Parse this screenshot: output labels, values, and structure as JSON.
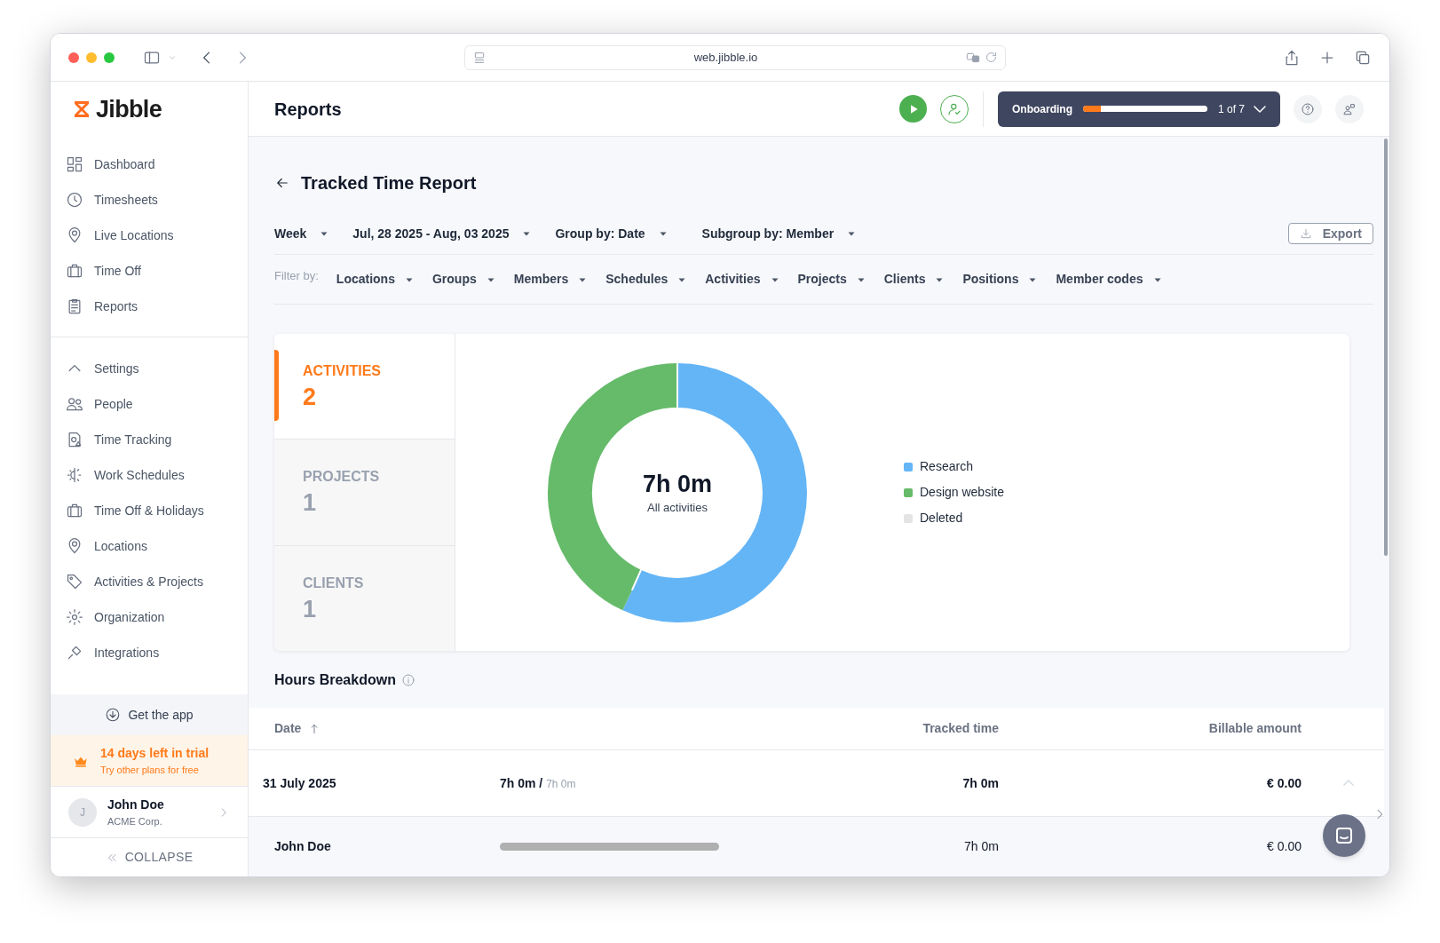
{
  "browser": {
    "url": "web.jibble.io"
  },
  "brand": {
    "name": "Jibble"
  },
  "sidebar": {
    "main_items": [
      {
        "label": "Dashboard"
      },
      {
        "label": "Timesheets"
      },
      {
        "label": "Live Locations"
      },
      {
        "label": "Time Off"
      },
      {
        "label": "Reports"
      }
    ],
    "settings": {
      "label": "Settings",
      "expanded": true,
      "children": [
        {
          "label": "People"
        },
        {
          "label": "Time Tracking"
        },
        {
          "label": "Work Schedules"
        },
        {
          "label": "Time Off & Holidays"
        },
        {
          "label": "Locations"
        },
        {
          "label": "Activities & Projects"
        },
        {
          "label": "Organization"
        },
        {
          "label": "Integrations"
        }
      ]
    },
    "get_app": "Get the app",
    "trial": {
      "title": "14 days left in trial",
      "subtitle": "Try other plans for free"
    },
    "user": {
      "initial": "J",
      "name": "John Doe",
      "company": "ACME Corp."
    },
    "collapse": "COLLAPSE"
  },
  "header": {
    "title": "Reports",
    "onboarding": {
      "label": "Onboarding",
      "level": 0.14,
      "count": "1 of 7"
    }
  },
  "report": {
    "title": "Tracked Time Report",
    "controls": [
      {
        "label": "Week"
      },
      {
        "label": "Jul, 28 2025 - Aug, 03 2025"
      },
      {
        "label": "Group by: Date"
      },
      {
        "label": "Subgroup by: Member"
      }
    ],
    "export": "Export",
    "filter_label": "Filter by:",
    "filters": [
      "Locations",
      "Groups",
      "Members",
      "Schedules",
      "Activities",
      "Projects",
      "Clients",
      "Positions",
      "Member codes"
    ],
    "summary_tabs": [
      {
        "label": "ACTIVITIES",
        "count": "2",
        "selected": true
      },
      {
        "label": "PROJECTS",
        "count": "1",
        "selected": false
      },
      {
        "label": "CLIENTS",
        "count": "1",
        "selected": false
      }
    ],
    "donut": {
      "total": "7h 0m",
      "caption": "All activities"
    },
    "legend": [
      {
        "label": "Research",
        "color": "#64b5f6"
      },
      {
        "label": "Design website",
        "color": "#66bb6a"
      },
      {
        "label": "Deleted",
        "color": "#e4e4e4"
      }
    ]
  },
  "breakdown": {
    "title": "Hours Breakdown",
    "columns": [
      "Date",
      "Tracked time",
      "Billable amount"
    ],
    "rows": [
      {
        "kind": "group",
        "date": "31 July 2025",
        "time": "7h 0m",
        "separator": "/",
        "planned": "7h 0m",
        "tracked": "7h 0m",
        "amount": "€ 0.00",
        "expanded": true
      },
      {
        "kind": "member",
        "name": "John Doe",
        "tracked": "7h 0m",
        "amount": "€ 0.00"
      }
    ]
  }
}
